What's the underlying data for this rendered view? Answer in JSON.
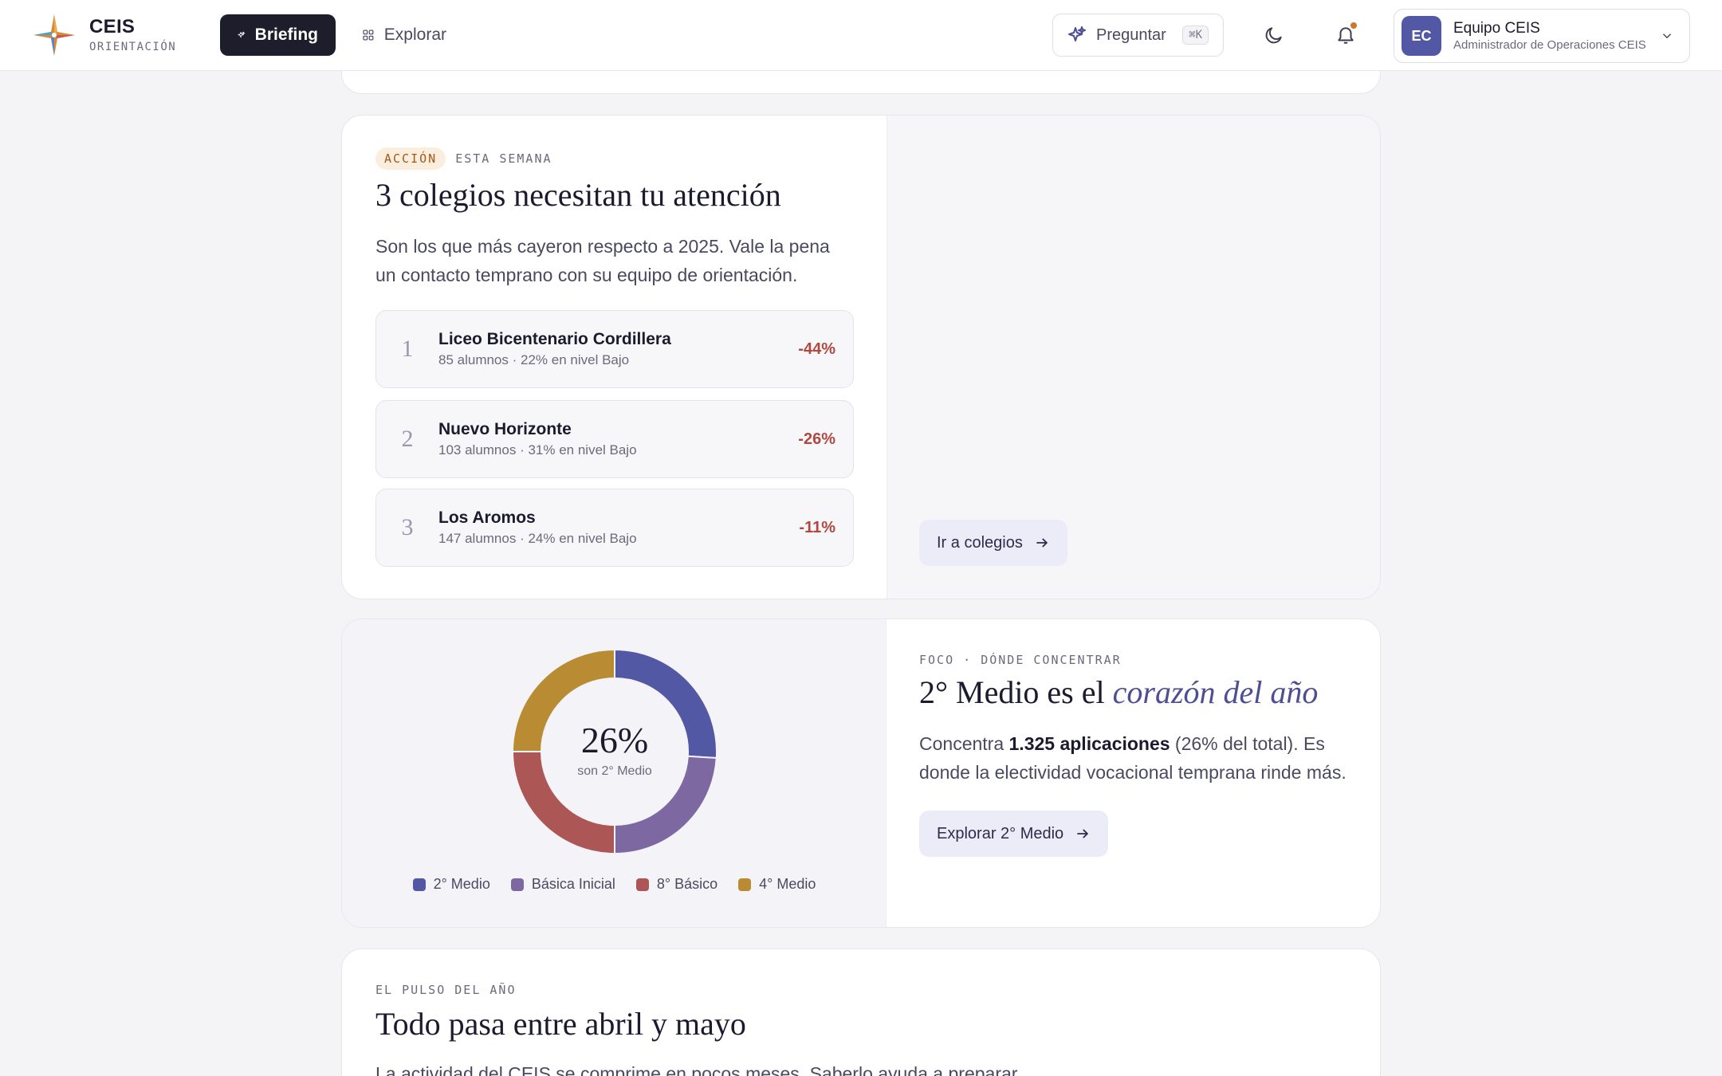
{
  "brand": {
    "name": "CEIS",
    "subtitle": "ORIENTACIÓN"
  },
  "nav": {
    "briefing": "Briefing",
    "explorar": "Explorar"
  },
  "ask": {
    "label": "Preguntar",
    "shortcut": "⌘K"
  },
  "user": {
    "initials": "EC",
    "name": "Equipo CEIS",
    "role": "Administrador de Operaciones CEIS"
  },
  "action": {
    "badge": "ACCIÓN",
    "eyebrow": "ESTA SEMANA",
    "title": "3 colegios necesitan tu atención",
    "body": "Son los que más cayeron respecto a 2025. Vale la pena un contacto temprano con su equipo de orientación.",
    "schools": [
      {
        "rank": "1",
        "name": "Liceo Bicentenario Cordillera",
        "detail": "85 alumnos · 22% en nivel Bajo",
        "delta": "-44%"
      },
      {
        "rank": "2",
        "name": "Nuevo Horizonte",
        "detail": "103 alumnos · 31% en nivel Bajo",
        "delta": "-26%"
      },
      {
        "rank": "3",
        "name": "Los Aromos",
        "detail": "147 alumnos · 24% en nivel Bajo",
        "delta": "-11%"
      }
    ],
    "cta": "Ir a colegios"
  },
  "focus": {
    "eyebrow": "FOCO · DÓNDE CONCENTRAR",
    "title_plain": "2° Medio es el ",
    "title_em": "corazón del año",
    "body_pre": "Concentra ",
    "body_bold": "1.325 aplicaciones",
    "body_post": " (26% del total). Es donde la electividad vocacional temprana rinde más.",
    "cta": "Explorar 2° Medio",
    "donut_value": "26%",
    "donut_label": "son 2° Medio"
  },
  "chart_data": {
    "type": "pie",
    "categories": [
      "2° Medio",
      "Básica Inicial",
      "8° Básico",
      "4° Medio"
    ],
    "values": [
      26,
      24,
      25,
      25
    ],
    "colors": [
      "#5358a4",
      "#7d68a2",
      "#ac5656",
      "#b98c34"
    ]
  },
  "pulse": {
    "eyebrow": "EL PULSO DEL AÑO",
    "title": "Todo pasa entre abril y mayo",
    "body": "La actividad del CEIS se comprime en pocos meses. Saberlo ayuda a preparar"
  }
}
